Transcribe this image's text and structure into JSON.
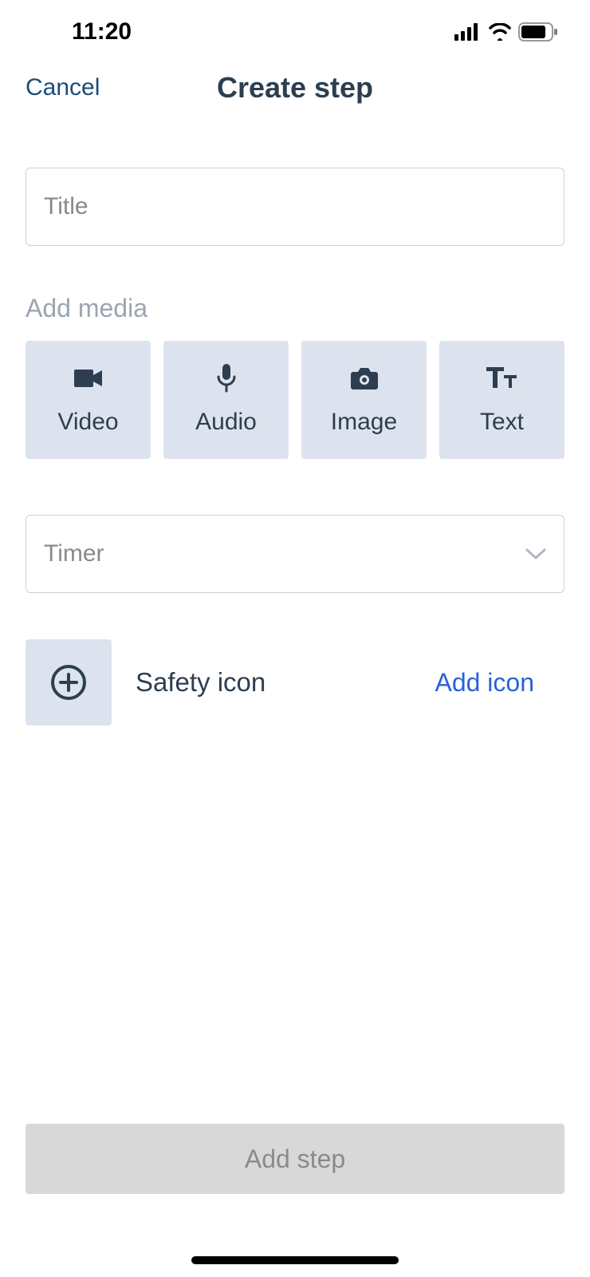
{
  "status_bar": {
    "time": "11:20"
  },
  "header": {
    "cancel_label": "Cancel",
    "title": "Create step"
  },
  "form": {
    "title_placeholder": "Title",
    "add_media_label": "Add media",
    "media_tiles": [
      {
        "label": "Video"
      },
      {
        "label": "Audio"
      },
      {
        "label": "Image"
      },
      {
        "label": "Text"
      }
    ],
    "timer_label": "Timer",
    "safety_icon_label": "Safety icon",
    "add_icon_link": "Add icon",
    "add_step_button": "Add step"
  }
}
